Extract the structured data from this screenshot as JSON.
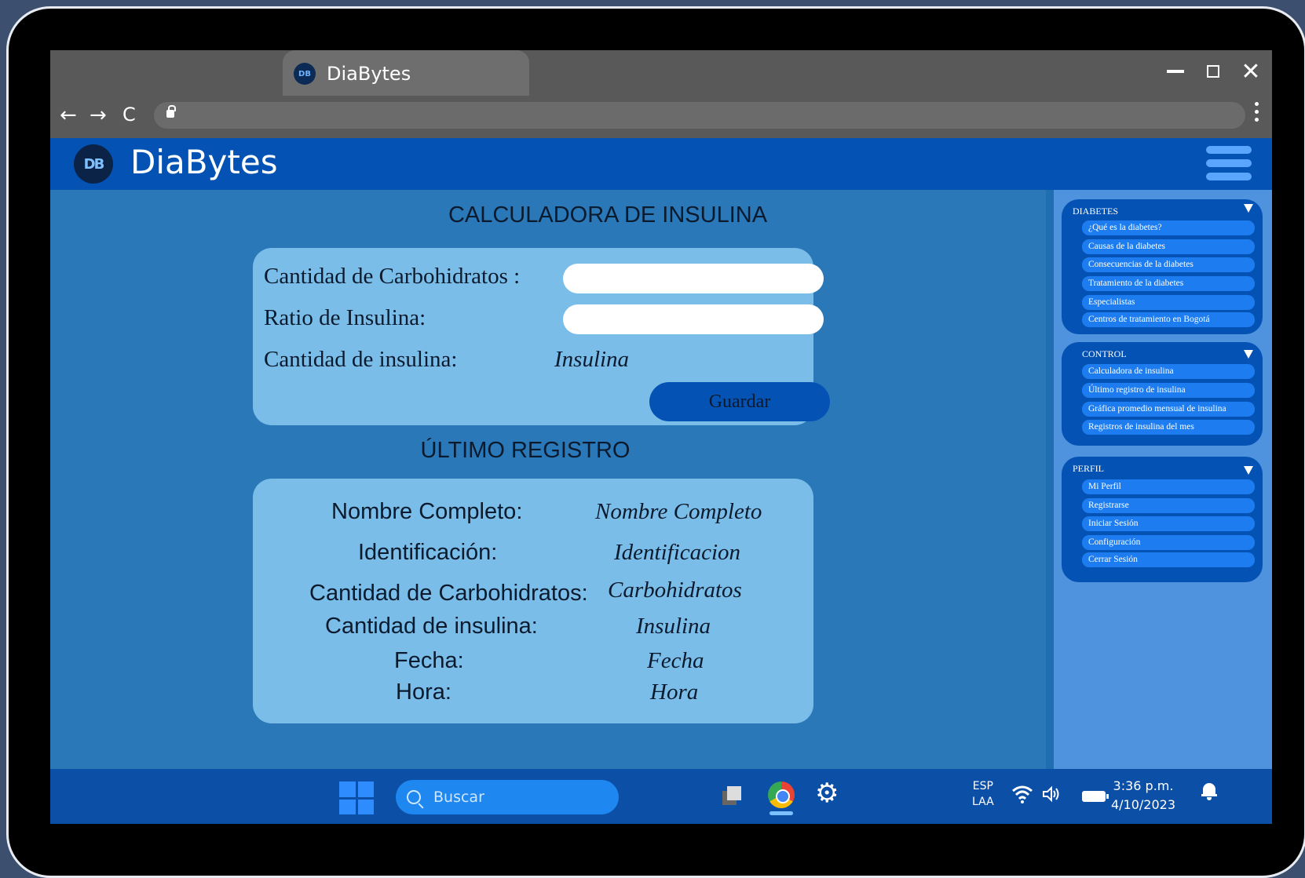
{
  "browser": {
    "tab_title": "DiaBytes",
    "tab_favicon_text": "DB",
    "nav_back": "←",
    "nav_forward": "→",
    "nav_reload": "C"
  },
  "app": {
    "logo_text": "DB",
    "title": "DiaBytes"
  },
  "calculator": {
    "title": "CALCULADORA DE INSULINA",
    "carbs_label": "Cantidad de Carbohidratos :",
    "ratio_label": "Ratio de Insulina:",
    "insulin_label": "Cantidad de insulina:",
    "insulin_value": "Insulina",
    "save_label": "Guardar"
  },
  "last_record": {
    "title": "ÚLTIMO REGISTRO",
    "rows": [
      {
        "label": "Nombre Completo:",
        "value": "Nombre Completo"
      },
      {
        "label": "Identificación:",
        "value": "Identificacion"
      },
      {
        "label": "Cantidad de Carbohidratos:",
        "value": "Carbohidratos"
      },
      {
        "label": "Cantidad de insulina:",
        "value": "Insulina"
      },
      {
        "label": "Fecha:",
        "value": "Fecha"
      },
      {
        "label": "Hora:",
        "value": "Hora"
      }
    ]
  },
  "sidebar": {
    "groups": [
      {
        "title": "DIABETES",
        "items": [
          "¿Qué es la diabetes?",
          "Causas de la diabetes",
          "Consecuencias de la diabetes",
          "Tratamiento de la diabetes",
          "Especialistas",
          "Centros de tratamiento en Bogotá"
        ]
      },
      {
        "title": "CONTROL",
        "items": [
          "Calculadora de insulina",
          "Último registro de insulina",
          "Gráfica promedio mensual de insulina",
          "Registros de insulina del mes"
        ]
      },
      {
        "title": "PERFIL",
        "items": [
          "Mi Perfil",
          "Registrarse",
          "Iniciar Sesión",
          "Configuración",
          "Cerrar Sesión"
        ]
      }
    ]
  },
  "taskbar": {
    "search_placeholder": "Buscar",
    "lang_top": "ESP",
    "lang_bottom": "LAA",
    "time": "3:36 p.m.",
    "date": "4/10/2023"
  }
}
